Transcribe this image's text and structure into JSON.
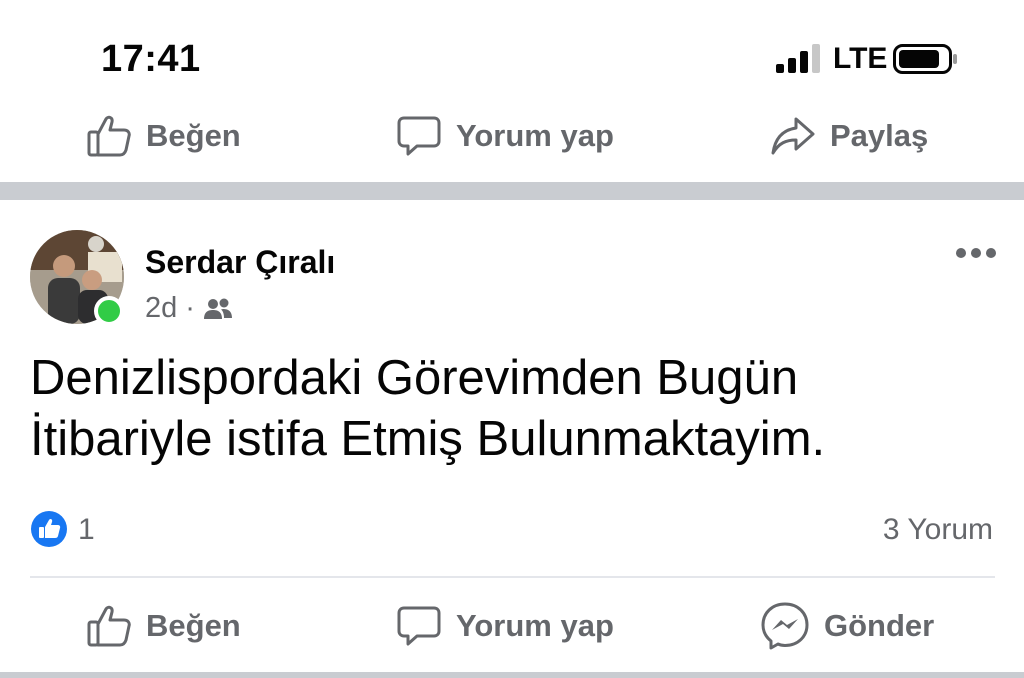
{
  "status_bar": {
    "time": "17:41",
    "network": "LTE",
    "signal_icon": "cellular-signal-icon",
    "battery_icon": "battery-icon"
  },
  "top_actions": {
    "like": {
      "label": "Beğen",
      "icon": "thumbs-up-outline-icon"
    },
    "comment": {
      "label": "Yorum yap",
      "icon": "comment-bubble-icon"
    },
    "share": {
      "label": "Paylaş",
      "icon": "share-arrow-icon"
    }
  },
  "post": {
    "author": "Serdar Çıralı",
    "time": "2d",
    "separator": "·",
    "audience_icon": "friends-icon",
    "online": true,
    "more_icon": "more-dots-icon",
    "text": "Denizlispordaki  Görevimden  Bugün\nİtibariyle istifa Etmiş Bulunmaktayim.",
    "reaction_icon": "like-reaction-icon",
    "reaction_count": "1",
    "comment_count": "3 Yorum"
  },
  "bottom_actions": {
    "like": {
      "label": "Beğen",
      "icon": "thumbs-up-outline-icon"
    },
    "comment": {
      "label": "Yorum yap",
      "icon": "comment-bubble-icon"
    },
    "send": {
      "label": "Gönder",
      "icon": "messenger-icon"
    }
  },
  "colors": {
    "text_primary": "#050505",
    "text_secondary": "#65676b",
    "separator": "#c9ccd1",
    "online": "#31cc46",
    "like_blue": "#1877f2"
  }
}
